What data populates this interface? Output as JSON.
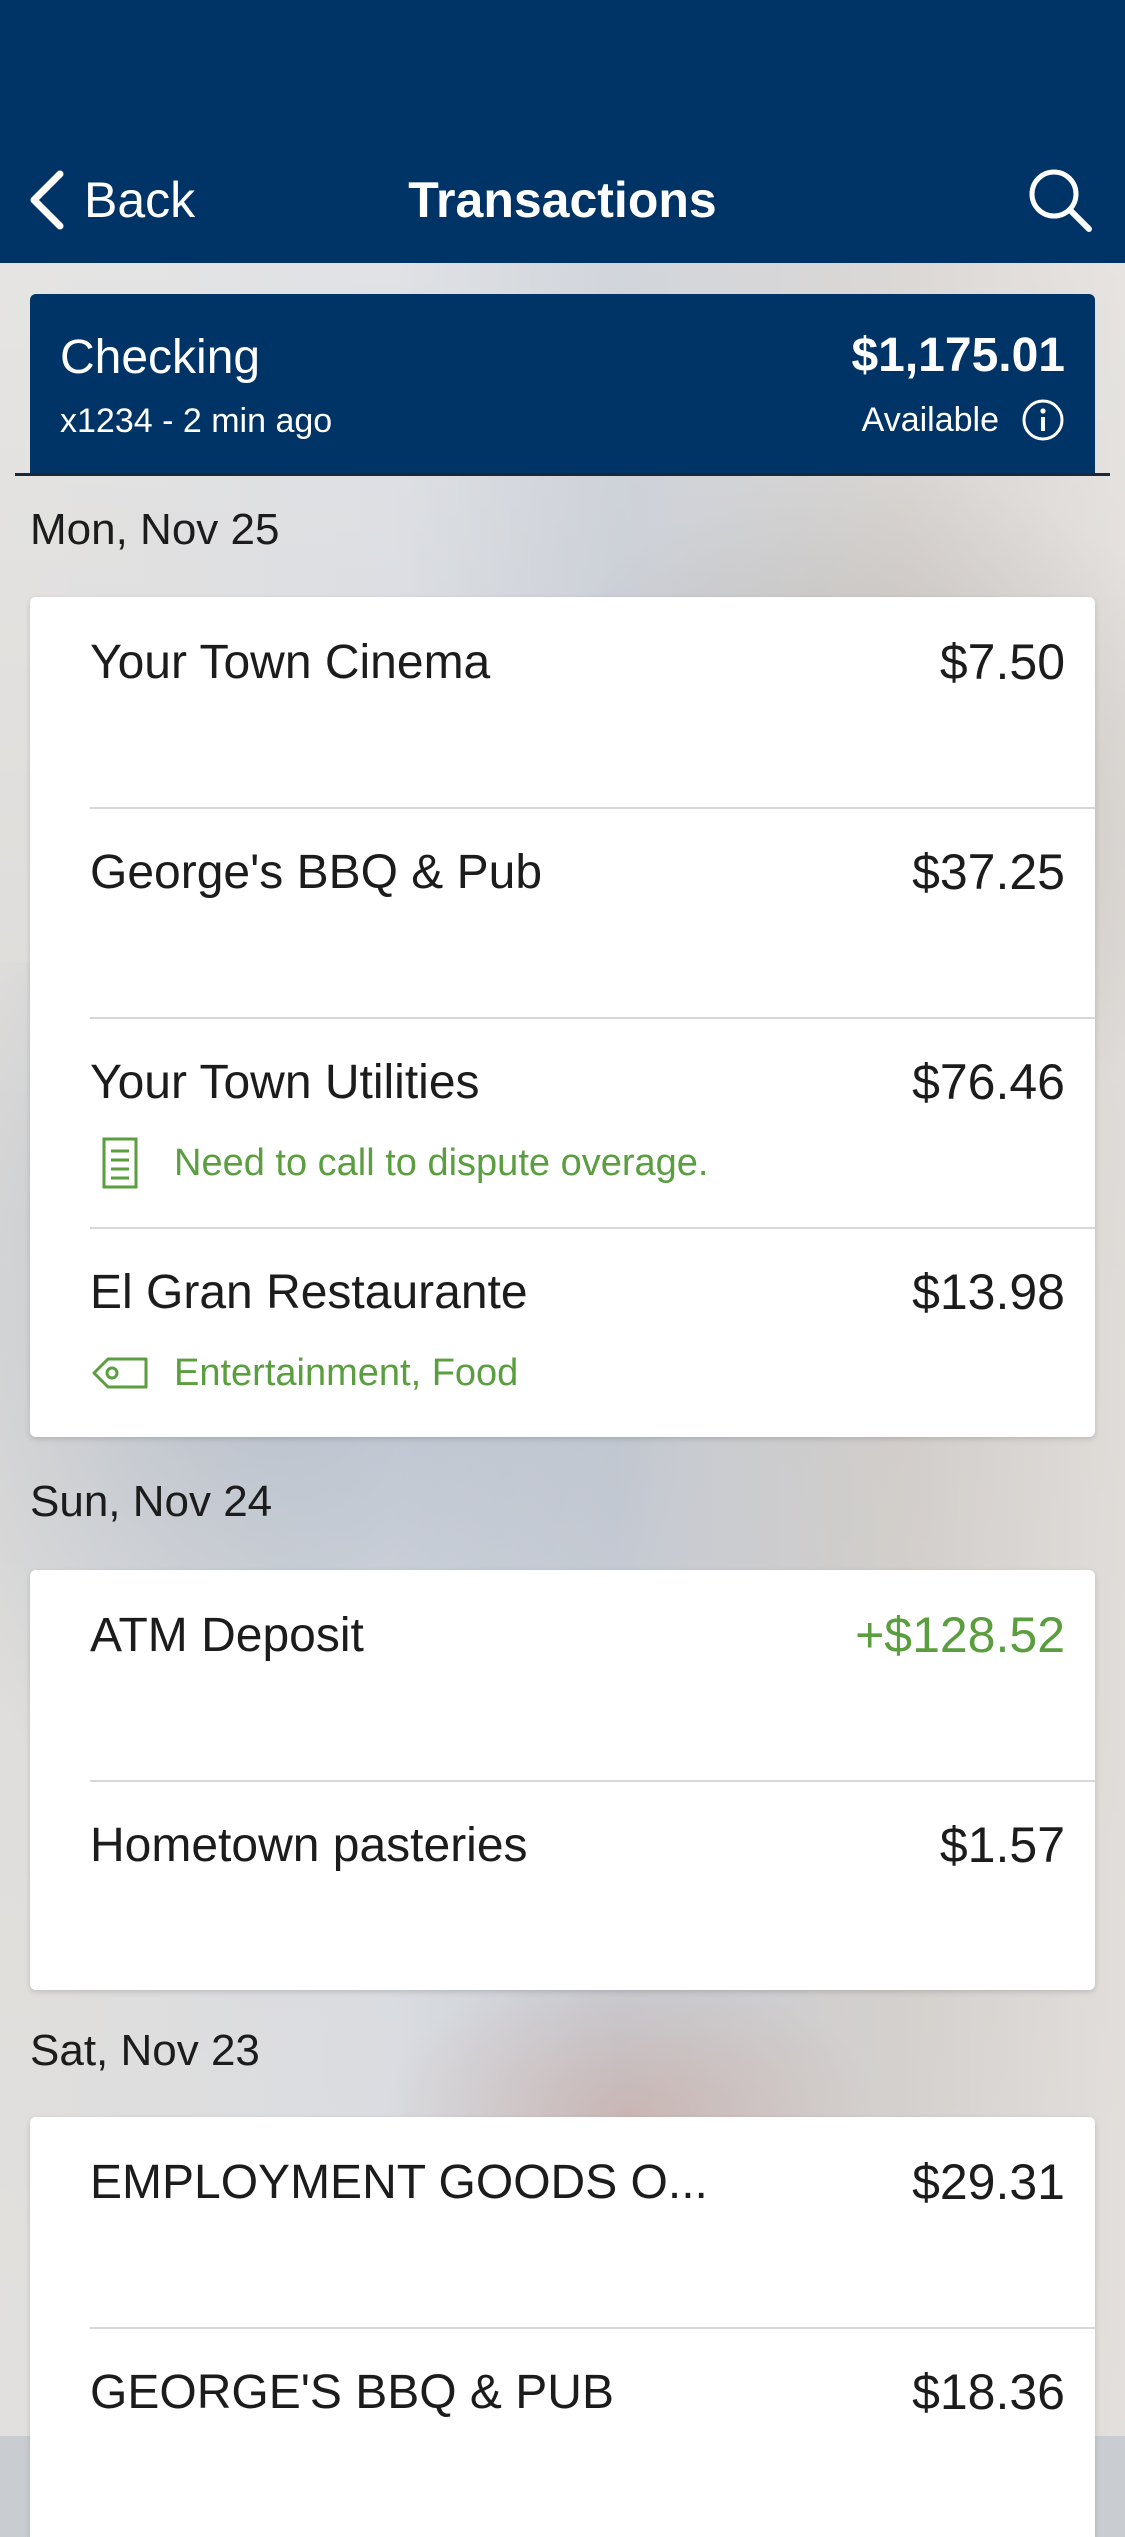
{
  "header": {
    "back_label": "Back",
    "title": "Transactions"
  },
  "account": {
    "name": "Checking",
    "meta": "x1234 - 2 min ago",
    "balance": "$1,175.01",
    "available_label": "Available"
  },
  "groups": [
    {
      "date": "Mon, Nov 25",
      "items": [
        {
          "merchant": "Your Town Cinema",
          "amount": "$7.50"
        },
        {
          "merchant": "George's BBQ & Pub",
          "amount": "$37.25"
        },
        {
          "merchant": "Your Town Utilities",
          "amount": "$76.46",
          "note": "Need to call to dispute overage.",
          "note_icon": "document-icon"
        },
        {
          "merchant": "El Gran Restaurante",
          "amount": "$13.98",
          "note": "Entertainment, Food",
          "note_icon": "tag-icon"
        }
      ]
    },
    {
      "date": "Sun, Nov 24",
      "items": [
        {
          "merchant": "ATM Deposit",
          "amount": "+$128.52"
        },
        {
          "merchant": "Hometown pasteries",
          "amount": "$1.57"
        }
      ]
    },
    {
      "date": "Sat, Nov 23",
      "items": [
        {
          "merchant": "EMPLOYMENT GOODS O...",
          "amount": "$29.31"
        },
        {
          "merchant": "GEORGE'S BBQ & PUB",
          "amount": "$18.36"
        }
      ]
    }
  ],
  "colors": {
    "header_bg": "#003366",
    "credit": "#5a9e3f",
    "note": "#5a9e3f"
  }
}
